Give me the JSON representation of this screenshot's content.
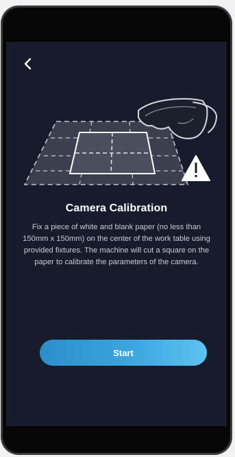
{
  "header": {
    "back_icon": "chevron-left-icon"
  },
  "illustration": {
    "icons": [
      "work-table-grid-icon",
      "safety-goggles-icon",
      "warning-icon"
    ]
  },
  "content": {
    "title": "Camera Calibration",
    "description": "Fix a piece of white and blank paper (no less than 150mm x 150mm) on the center of the work table using provided fixtures. The machine will cut a square on the paper to calibrate the parameters of the camera."
  },
  "actions": {
    "start_label": "Start"
  },
  "colors": {
    "screen_background": "#181b2b",
    "button_gradient_start": "#2b8ec9",
    "button_gradient_end": "#5ec3f0",
    "text_primary": "#ffffff",
    "text_secondary": "#c9cbd4"
  }
}
